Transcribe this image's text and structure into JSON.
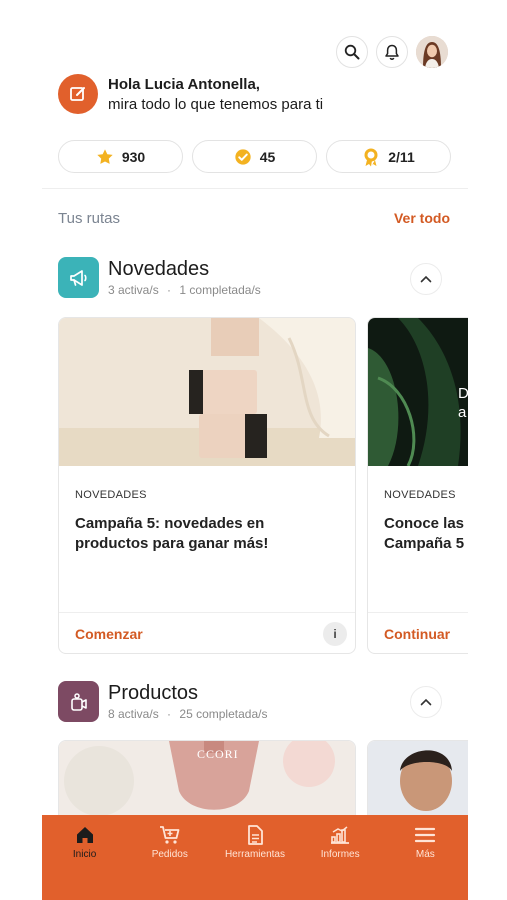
{
  "greeting": {
    "line1": "Hola Lucia Antonella,",
    "line2": "mira todo lo que tenemos para ti"
  },
  "stats": [
    {
      "icon": "star-icon",
      "value": "930",
      "color": "#f3b221"
    },
    {
      "icon": "check-badge-icon",
      "value": "45",
      "color": "#f3b221"
    },
    {
      "icon": "award-icon",
      "value": "2/11",
      "color": "#f3b221"
    }
  ],
  "routes": {
    "title": "Tus rutas",
    "see_all": "Ver todo"
  },
  "sections": [
    {
      "title": "Novedades",
      "active": "3 activa/s",
      "completed": "1 completada/s",
      "icon_color": "#3bb3b8",
      "cards": [
        {
          "tag": "NOVEDADES",
          "title": "Campaña 5: novedades en productos para ganar más!",
          "action": "Comenzar",
          "info": "i"
        },
        {
          "tag": "NOVEDADES",
          "title": "Conoce las Campaña 5",
          "action": "Continuar"
        }
      ]
    },
    {
      "title": "Productos",
      "active": "8 activa/s",
      "completed": "25 completada/s",
      "icon_color": "#7d4a63"
    }
  ],
  "card_image_text": {
    "brand": "CCORI",
    "partial": "D a"
  },
  "bottom_nav": [
    {
      "label": "Inicio",
      "icon": "home-icon",
      "active": true
    },
    {
      "label": "Pedidos",
      "icon": "cart-icon",
      "active": false
    },
    {
      "label": "Herramientas",
      "icon": "document-icon",
      "active": false
    },
    {
      "label": "Informes",
      "icon": "bar-chart-icon",
      "active": false
    },
    {
      "label": "Más",
      "icon": "menu-icon",
      "active": false
    }
  ],
  "colors": {
    "brand": "#e1602c",
    "link": "#d35a23",
    "star": "#f3b221"
  },
  "separator": "·"
}
